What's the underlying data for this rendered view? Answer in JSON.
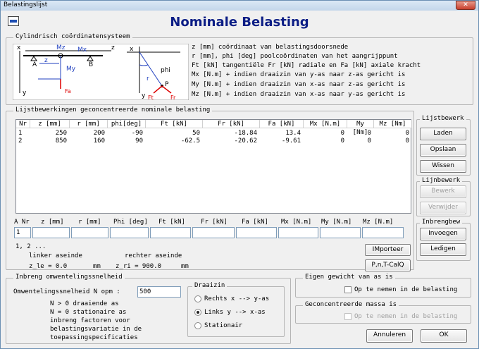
{
  "window": {
    "title": "Belastingslijst",
    "close": "✕",
    "heading": "Nominale Belasting"
  },
  "cyl": {
    "legend": "Cylindrisch  coördinatensysteem",
    "lines": [
      "z [mm] coördinaat van belastingsdoorsnede",
      "r [mm], phi [deg] poolcoördinaten van het aangrijppunt",
      "Ft [kN] tangentiële  Fr [kN] radiale en  Fa [kN] axiale kracht",
      "Mx [N.m] + indien draaizin van y-as naar z-as gericht is",
      "My [N.m] + indien draaizin van x-as naar z-as gericht is",
      "Mz [N.m] + indien draaizin van x-as naar y-as gericht is"
    ],
    "diagram": {
      "x": "x",
      "z": "z",
      "y": "y",
      "A": "A",
      "B": "B",
      "Mz": "Mz",
      "Mx": "Mx",
      "My": "My",
      "Fa": "Fa",
      "phi": "phi",
      "r": "r",
      "P": "P",
      "Ft": "Ft",
      "Fr": "Fr"
    }
  },
  "list": {
    "legend": "Lijstbewerkingen geconcentreerde nominale belasting",
    "headers": [
      "Nr",
      "z [mm]",
      "r [mm]",
      "phi[deg]",
      "Ft [kN]",
      "Fr [kN]",
      "Fa [kN]",
      "Mx [N.m]",
      "My [Nm]",
      "Mz [Nm]"
    ],
    "rows": [
      [
        "1",
        "250",
        "200",
        "-90",
        "50",
        "-18.84",
        "13.4",
        "0",
        "0",
        "0"
      ],
      [
        "2",
        "850",
        "160",
        "90",
        "-62.5",
        "-20.62",
        "-9.61",
        "0",
        "0",
        "0"
      ]
    ]
  },
  "entry": {
    "labels": [
      "A Nr",
      "z [mm]",
      "r [mm]",
      "Phi [deg]",
      "Ft [kN]",
      "Fr [kN]",
      "Fa [kN]",
      "Mx [N.m]",
      "My [N.m]",
      "Mz [N.m]"
    ],
    "nr_value": "1"
  },
  "ends": {
    "seq": "1, 2 ...",
    "left_label": "linker aseinde",
    "right_label": "rechter aseinde",
    "left_val": "z_le = 0.0",
    "right_val": "z_ri = 900.0",
    "unit": "mm"
  },
  "lijstbewerk": {
    "legend": "Lijstbewerk",
    "laden": "Laden",
    "opslaan": "Opslaan",
    "wissen": "Wissen"
  },
  "lijnbewerk": {
    "legend": "Lijnbewerk",
    "bewerk": "Bewerk",
    "verwijder": "Verwijder"
  },
  "inbreng": {
    "legend": "Inbrengbew",
    "invoegen": "Invoegen",
    "ledigen": "Ledigen"
  },
  "import": {
    "importeer": "IMporteer",
    "calq": "P,n,T-CalQ"
  },
  "speed": {
    "legend": "Inbreng omwentelingssnelheid",
    "label": "Omwentelingssnelheid   N  opm :",
    "value": "500",
    "notes": [
      "N > 0  draaiende as",
      "N = 0  stationaire as",
      "inbreng factoren voor",
      "belastingsvariatie in de",
      "toepassingspecificaties"
    ]
  },
  "draaizin": {
    "legend": "Draaizin",
    "opts": [
      "Rechts x --> y-as",
      "Links  y --> x-as",
      "Stationair"
    ],
    "selected": 1
  },
  "eigen": {
    "legend": "Eigen gewicht van as is",
    "check": "Op te nemen in de belasting"
  },
  "geconc": {
    "legend": "Geconcentreerde massa is",
    "check": "Op te nemen in de belasting"
  },
  "actions": {
    "cancel": "Annuleren",
    "ok": "OK"
  }
}
